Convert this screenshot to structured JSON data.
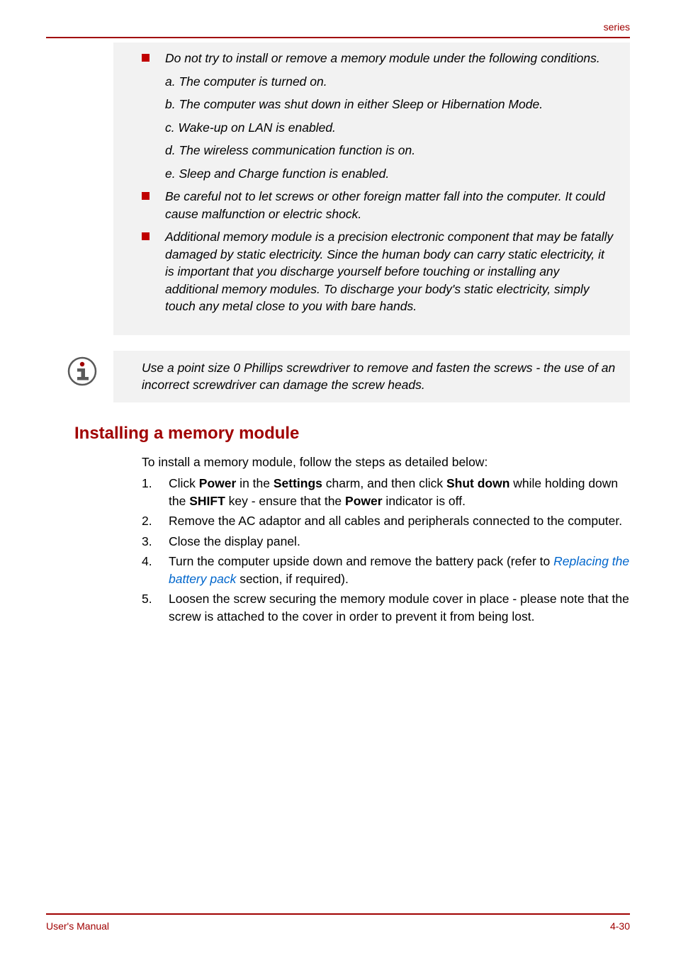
{
  "header": {
    "series": "series"
  },
  "warnings": {
    "item1": {
      "text": "Do not try to install or remove a memory module under the following conditions.",
      "sub_a": "a. The computer is turned on.",
      "sub_b": "b. The computer was shut down in either Sleep or Hibernation Mode.",
      "sub_c": "c. Wake-up on LAN is enabled.",
      "sub_d": "d. The wireless communication function is on.",
      "sub_e": "e. Sleep and Charge function is enabled."
    },
    "item2": "Be careful not to let screws or other foreign matter fall into the computer. It could cause malfunction or electric shock.",
    "item3": "Additional memory module is a precision electronic component that may be fatally damaged by static electricity. Since the human body can carry static electricity, it is important that you discharge yourself before touching or installing any additional memory modules. To discharge your body's static electricity, simply touch any metal close to you with bare hands."
  },
  "info_note": "Use a point size 0 Phillips screwdriver to remove and fasten the screws - the use of an incorrect screwdriver can damage the screw heads.",
  "section": {
    "heading": "Installing a memory module",
    "intro": "To install a memory module, follow the steps as detailed below:",
    "steps": {
      "n1": "1.",
      "t1a": "Click ",
      "t1_power": "Power",
      "t1b": " in the ",
      "t1_settings": "Settings",
      "t1c": " charm, and then click ",
      "t1_shutdown": "Shut down",
      "t1d": " while holding down the ",
      "t1_shift": "SHIFT",
      "t1e": " key - ensure that the ",
      "t1_power2": "Power",
      "t1f": " indicator is off.",
      "n2": "2.",
      "t2": "Remove the AC adaptor and all cables and peripherals connected to the computer.",
      "n3": "3.",
      "t3": "Close the display panel.",
      "n4": "4.",
      "t4a": "Turn the computer upside down and remove the battery pack (refer to ",
      "t4_link": "Replacing the battery pack",
      "t4b": " section, if required).",
      "n5": "5.",
      "t5": "Loosen the screw securing the memory module cover in place - please note that the screw is attached to the cover in order to prevent it from being lost."
    }
  },
  "footer": {
    "left": "User's Manual",
    "right": "4-30"
  }
}
